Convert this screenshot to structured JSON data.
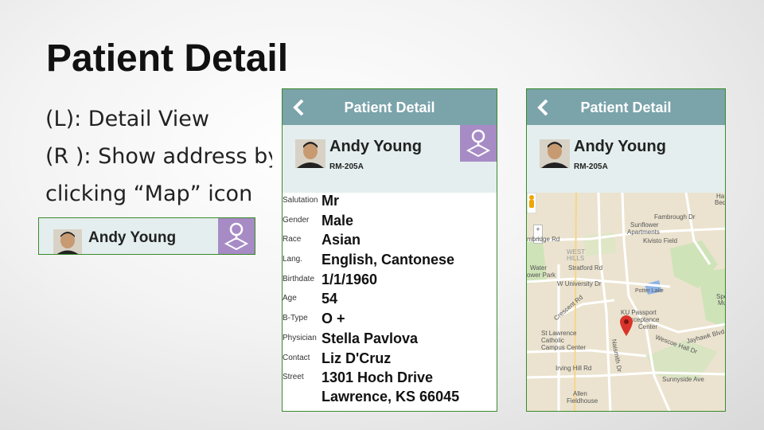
{
  "slide": {
    "title": "Patient Detail",
    "bullets": [
      "(L): Detail View",
      "(R ): Show address by",
      "clicking “Map” icon"
    ]
  },
  "mini_banner": {
    "name": "Andy Young"
  },
  "phone_left": {
    "nav_title": "Patient Detail",
    "patient": {
      "name": "Andy Young",
      "room": "RM-205A"
    },
    "fields": [
      {
        "label": "Salutation",
        "value": "Mr"
      },
      {
        "label": "Gender",
        "value": "Male"
      },
      {
        "label": "Race",
        "value": "Asian"
      },
      {
        "label": "Lang.",
        "value": "English, Cantonese"
      },
      {
        "label": "Birthdate",
        "value": "1/1/1960"
      },
      {
        "label": "Age",
        "value": "54"
      },
      {
        "label": "B-Type",
        "value": "O +"
      },
      {
        "label": "Physician",
        "value": "Stella Pavlova"
      },
      {
        "label": "Contact",
        "value": "Liz D'Cruz"
      },
      {
        "label": "Street",
        "value": "1301 Hoch Drive",
        "value2": "Lawrence, KS 66045"
      }
    ]
  },
  "phone_right": {
    "nav_title": "Patient Detail",
    "patient": {
      "name": "Andy Young",
      "room": "RM-205A"
    },
    "map_labels": {
      "fambrough": "Fambrough Dr",
      "sunflower": "Sunflower",
      "apartments": "Apartments",
      "kivisto": "Kivisto Field",
      "west": "WEST",
      "hills": "HILLS",
      "stratford": "Stratford Rd",
      "bridge": "mbridge Rd",
      "water": "Water",
      "power_park": "ower Park",
      "univ": "W University Dr",
      "potter": "Potter Lake",
      "ku_passport": "KU Passport",
      "acceptance": "cceptance",
      "center": "Center",
      "st_lawrence": "St Lawrence",
      "catholic": "Catholic",
      "campus_center": "Campus Center",
      "irving": "Irving Hill Rd",
      "sunnyside": "Sunnyside Ave",
      "allen": "Allen",
      "fieldhouse": "Fieldhouse",
      "wescoe": "Wescoe Hall Dr",
      "jayhawk": "Jayhawk Blvd",
      "crescent": "Crescent Rd",
      "naismith": "Naismith Dr",
      "ha": "Ha",
      "bed": "Bed",
      "spe": "Spe",
      "mu": "Mu",
      "zoom_in": "+",
      "zoom_out": "−"
    }
  },
  "colors": {
    "nav_bar": "#7aa3aa",
    "header_bg": "#e4eeee",
    "map_button": "#a78bc5",
    "border": "#3a8a2c",
    "map_pin": "#d9332b"
  },
  "icons": {
    "back": "chevron-left-icon",
    "map": "map-pin-icon",
    "avatar": "avatar"
  }
}
